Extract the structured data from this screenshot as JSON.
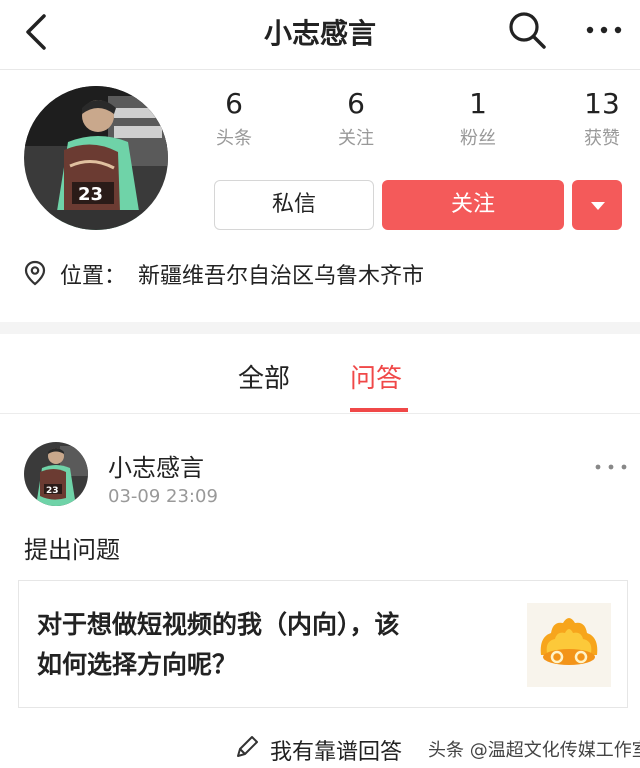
{
  "header": {
    "title": "小志感言"
  },
  "profile": {
    "stats": [
      {
        "value": "6",
        "label": "头条"
      },
      {
        "value": "6",
        "label": "关注"
      },
      {
        "value": "1",
        "label": "粉丝"
      },
      {
        "value": "13",
        "label": "获赞"
      }
    ],
    "message_label": "私信",
    "follow_label": "关注",
    "location_label": "位置：",
    "location_value": "新疆维吾尔自治区乌鲁木齐市"
  },
  "tabs": [
    {
      "label": "全部",
      "active": false
    },
    {
      "label": "问答",
      "active": true
    }
  ],
  "post": {
    "author": "小志感言",
    "time": "03-09 23:09",
    "body": "提出问题",
    "question_line1": "对于想做短视频的我（内向），该",
    "question_line2": "如何选择方向呢？",
    "answer_label": "我有靠谱回答"
  },
  "watermark": "头条 @温超文化传媒工作室",
  "colors": {
    "accent": "#f45a5a",
    "tab_active": "#f04848"
  },
  "icons": [
    "back-arrow-icon",
    "search-icon",
    "more-icon",
    "location-pin-icon",
    "dropdown-caret-icon",
    "pencil-icon",
    "crown-icon"
  ]
}
